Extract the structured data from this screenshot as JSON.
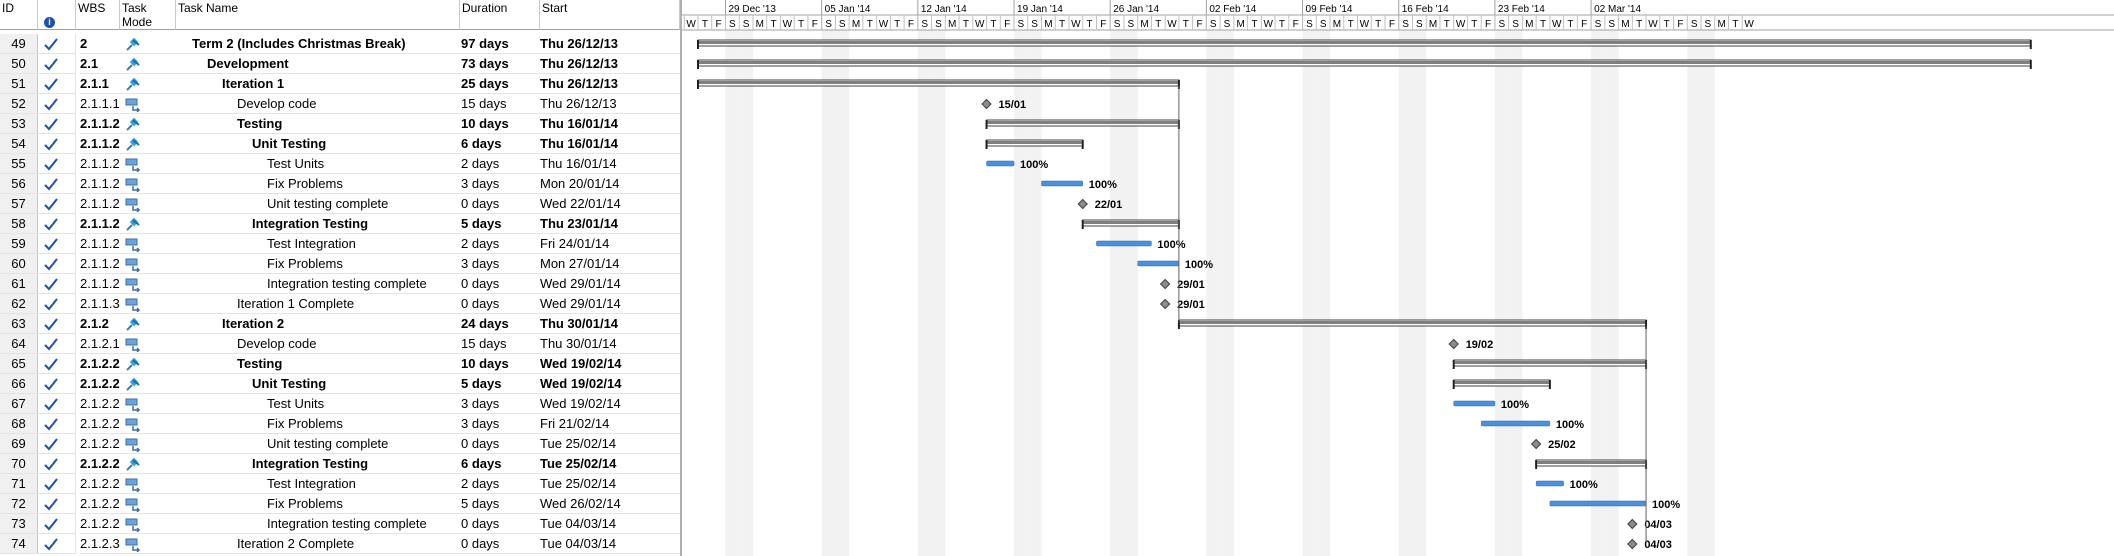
{
  "headers": {
    "id": "ID",
    "info": "i",
    "wbs": "WBS",
    "mode": "Task Mode",
    "name": "Task Name",
    "duration": "Duration",
    "start": "Start"
  },
  "timescale": {
    "weeks": [
      "29 Dec '13",
      "05 Jan '14",
      "12 Jan '14",
      "19 Jan '14",
      "26 Jan '14",
      "02 Feb '14",
      "09 Feb '14",
      "16 Feb '14",
      "23 Feb '14",
      "02 Mar '14"
    ],
    "day_letters": [
      "W",
      "T",
      "F",
      "S",
      "S",
      "M",
      "T",
      "W",
      "T",
      "F",
      "S",
      "S",
      "M",
      "T",
      "W",
      "T",
      "F",
      "S",
      "S",
      "M",
      "T",
      "W",
      "T",
      "F",
      "S",
      "S",
      "M",
      "T",
      "W",
      "T",
      "F",
      "S",
      "S",
      "M",
      "T",
      "W",
      "T",
      "F",
      "S",
      "S",
      "M",
      "T",
      "W",
      "T",
      "F",
      "S",
      "S",
      "M",
      "T",
      "W",
      "T",
      "F",
      "S",
      "S",
      "M",
      "T",
      "W",
      "T",
      "F",
      "S",
      "S",
      "M",
      "T",
      "W",
      "T",
      "F",
      "S",
      "S",
      "M",
      "T",
      "W",
      "T",
      "F",
      "S",
      "S",
      "M",
      "T",
      "W"
    ]
  },
  "colors": {
    "summary": "#7f7f7f",
    "task": "#4f8fd8",
    "milestone": "#8c8c8c",
    "weekend": "#f2f2f2",
    "check": "#1f4fb0"
  },
  "tasks": [
    {
      "id": "49",
      "wbs": "2",
      "name": "Term 2 (Includes Christmas Break)",
      "duration": "97 days",
      "start": "Thu 26/12/13",
      "level": 1,
      "bold": true,
      "mode": "auto",
      "kind": "summary",
      "s": 0,
      "e": 97
    },
    {
      "id": "50",
      "wbs": "2.1",
      "name": "Development",
      "duration": "73 days",
      "start": "Thu 26/12/13",
      "level": 2,
      "bold": true,
      "mode": "auto",
      "kind": "summary",
      "s": 0,
      "e": 97
    },
    {
      "id": "51",
      "wbs": "2.1.1",
      "name": "Iteration 1",
      "duration": "25 days",
      "start": "Thu 26/12/13",
      "level": 3,
      "bold": true,
      "mode": "auto",
      "kind": "summary",
      "s": 0,
      "e": 35
    },
    {
      "id": "52",
      "wbs": "2.1.1.1",
      "name": "Develop code",
      "duration": "15 days",
      "start": "Thu 26/12/13",
      "level": 4,
      "bold": false,
      "mode": "manual",
      "kind": "milestone",
      "s": 21,
      "label": "15/01"
    },
    {
      "id": "53",
      "wbs": "2.1.1.2",
      "name": "Testing",
      "duration": "10 days",
      "start": "Thu 16/01/14",
      "level": 4,
      "bold": true,
      "mode": "auto",
      "kind": "summary",
      "s": 21,
      "e": 35
    },
    {
      "id": "54",
      "wbs": "2.1.1.2.",
      "name": "Unit Testing",
      "duration": "6 days",
      "start": "Thu 16/01/14",
      "level": 5,
      "bold": true,
      "mode": "auto",
      "kind": "summary",
      "s": 21,
      "e": 28
    },
    {
      "id": "55",
      "wbs": "2.1.1.2.",
      "name": "Test Units",
      "duration": "2 days",
      "start": "Thu 16/01/14",
      "level": 6,
      "bold": false,
      "mode": "manual",
      "kind": "task",
      "s": 21,
      "e": 23,
      "label": "100%"
    },
    {
      "id": "56",
      "wbs": "2.1.1.2.",
      "name": "Fix Problems",
      "duration": "3 days",
      "start": "Mon 20/01/14",
      "level": 6,
      "bold": false,
      "mode": "manual",
      "kind": "task",
      "s": 25,
      "e": 28,
      "label": "100%"
    },
    {
      "id": "57",
      "wbs": "2.1.1.2.",
      "name": "Unit testing complete",
      "duration": "0 days",
      "start": "Wed 22/01/14",
      "level": 6,
      "bold": false,
      "mode": "manual",
      "kind": "milestone",
      "s": 28,
      "label": "22/01"
    },
    {
      "id": "58",
      "wbs": "2.1.1.2.",
      "name": "Integration Testing",
      "duration": "5 days",
      "start": "Thu 23/01/14",
      "level": 5,
      "bold": true,
      "mode": "auto",
      "kind": "summary",
      "s": 28,
      "e": 35
    },
    {
      "id": "59",
      "wbs": "2.1.1.2.",
      "name": "Test Integration",
      "duration": "2 days",
      "start": "Fri 24/01/14",
      "level": 6,
      "bold": false,
      "mode": "manual",
      "kind": "task",
      "s": 29,
      "e": 33,
      "label": "100%"
    },
    {
      "id": "60",
      "wbs": "2.1.1.2.",
      "name": "Fix Problems",
      "duration": "3 days",
      "start": "Mon 27/01/14",
      "level": 6,
      "bold": false,
      "mode": "manual",
      "kind": "task",
      "s": 32,
      "e": 35,
      "label": "100%"
    },
    {
      "id": "61",
      "wbs": "2.1.1.2.",
      "name": "Integration testing complete",
      "duration": "0 days",
      "start": "Wed 29/01/14",
      "level": 6,
      "bold": false,
      "mode": "manual",
      "kind": "milestone",
      "s": 34,
      "label": "29/01"
    },
    {
      "id": "62",
      "wbs": "2.1.1.3",
      "name": "Iteration 1 Complete",
      "duration": "0 days",
      "start": "Wed 29/01/14",
      "level": 4,
      "bold": false,
      "mode": "manual",
      "kind": "milestone",
      "s": 34,
      "label": "29/01"
    },
    {
      "id": "63",
      "wbs": "2.1.2",
      "name": "Iteration 2",
      "duration": "24 days",
      "start": "Thu 30/01/14",
      "level": 3,
      "bold": true,
      "mode": "auto",
      "kind": "summary",
      "s": 35,
      "e": 69
    },
    {
      "id": "64",
      "wbs": "2.1.2.1",
      "name": "Develop code",
      "duration": "15 days",
      "start": "Thu 30/01/14",
      "level": 4,
      "bold": false,
      "mode": "manual",
      "kind": "milestone",
      "s": 55,
      "label": "19/02"
    },
    {
      "id": "65",
      "wbs": "2.1.2.2",
      "name": "Testing",
      "duration": "10 days",
      "start": "Wed 19/02/14",
      "level": 4,
      "bold": true,
      "mode": "auto",
      "kind": "summary",
      "s": 55,
      "e": 69
    },
    {
      "id": "66",
      "wbs": "2.1.2.2.",
      "name": "Unit Testing",
      "duration": "5 days",
      "start": "Wed 19/02/14",
      "level": 5,
      "bold": true,
      "mode": "auto",
      "kind": "summary",
      "s": 55,
      "e": 62
    },
    {
      "id": "67",
      "wbs": "2.1.2.2.",
      "name": "Test Units",
      "duration": "3 days",
      "start": "Wed 19/02/14",
      "level": 6,
      "bold": false,
      "mode": "manual",
      "kind": "task",
      "s": 55,
      "e": 58,
      "label": "100%"
    },
    {
      "id": "68",
      "wbs": "2.1.2.2.",
      "name": "Fix Problems",
      "duration": "3 days",
      "start": "Fri 21/02/14",
      "level": 6,
      "bold": false,
      "mode": "manual",
      "kind": "task",
      "s": 57,
      "e": 62,
      "label": "100%"
    },
    {
      "id": "69",
      "wbs": "2.1.2.2.",
      "name": "Unit testing complete",
      "duration": "0 days",
      "start": "Tue 25/02/14",
      "level": 6,
      "bold": false,
      "mode": "manual",
      "kind": "milestone",
      "s": 61,
      "label": "25/02"
    },
    {
      "id": "70",
      "wbs": "2.1.2.2.",
      "name": "Integration Testing",
      "duration": "6 days",
      "start": "Tue 25/02/14",
      "level": 5,
      "bold": true,
      "mode": "auto",
      "kind": "summary",
      "s": 61,
      "e": 69
    },
    {
      "id": "71",
      "wbs": "2.1.2.2.",
      "name": "Test Integration",
      "duration": "2 days",
      "start": "Tue 25/02/14",
      "level": 6,
      "bold": false,
      "mode": "manual",
      "kind": "task",
      "s": 61,
      "e": 63,
      "label": "100%"
    },
    {
      "id": "72",
      "wbs": "2.1.2.2.",
      "name": "Fix Problems",
      "duration": "5 days",
      "start": "Wed 26/02/14",
      "level": 6,
      "bold": false,
      "mode": "manual",
      "kind": "task",
      "s": 62,
      "e": 69,
      "label": "100%"
    },
    {
      "id": "73",
      "wbs": "2.1.2.2.",
      "name": "Integration testing complete",
      "duration": "0 days",
      "start": "Tue 04/03/14",
      "level": 6,
      "bold": false,
      "mode": "manual",
      "kind": "milestone",
      "s": 68,
      "label": "04/03"
    },
    {
      "id": "74",
      "wbs": "2.1.2.3",
      "name": "Iteration 2 Complete",
      "duration": "0 days",
      "start": "Tue 04/03/14",
      "level": 4,
      "bold": false,
      "mode": "manual",
      "kind": "milestone",
      "s": 68,
      "label": "04/03"
    }
  ]
}
